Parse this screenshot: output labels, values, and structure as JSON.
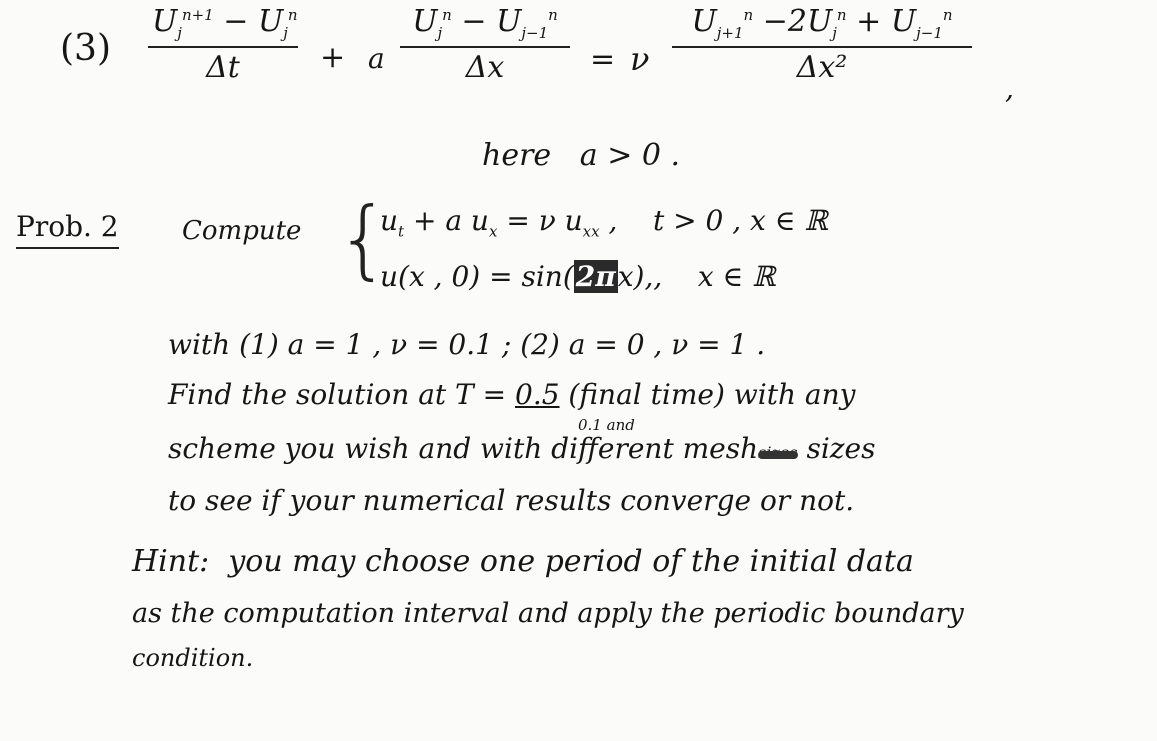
{
  "equation3": {
    "label": "(3)",
    "term1": {
      "numerator": "U_j^{n+1} − U_j^n",
      "num_a": "U",
      "num_a_sup": "n+1",
      "num_a_sub": "j",
      "num_op": "−",
      "num_b": "U",
      "num_b_sup": "n",
      "num_b_sub": "j",
      "denominator": "Δt"
    },
    "plus": "+",
    "coef": "a",
    "term2": {
      "num_a": "U",
      "num_a_sup": "n",
      "num_a_sub": "j",
      "num_op": "−",
      "num_b": "U",
      "num_b_sup": "n",
      "num_b_sub": "j−1",
      "denominator": "Δx"
    },
    "equals": "=",
    "nu": "ν",
    "term3": {
      "num_a": "U",
      "num_a_sup": "n",
      "num_a_sub": "j+1",
      "num_mid": "−2",
      "num_b": "U",
      "num_b_sup": "n",
      "num_b_sub": "j",
      "num_op": "+",
      "num_c": "U",
      "num_c_sup": "n",
      "num_c_sub": "j−1",
      "denominator": "Δx²"
    },
    "trailing": ",",
    "condition": "here   a > 0 ."
  },
  "problem": {
    "title": "Prob. 2",
    "verb": "Compute",
    "pde_line": "u_t + a u_x = ν u_xx ,    t > 0 , x ∈ ℝ",
    "pde_lhs": "u",
    "pde_t": "t",
    "pde_mid": " + a u",
    "pde_x": "x",
    "pde_eq": " = ν u",
    "pde_xx": "xx",
    "pde_cond": " ,    t > 0 , x ∈ ℝ",
    "ic_lhs": "u(x , 0) = sin",
    "ic_arg_open": "(",
    "ic_arg_highlight": "2π",
    "ic_arg_rest": "x),",
    "ic_cond": ",    x ∈ ℝ",
    "cases_line": "with (1) a = 1 , ν = 0.1 ; (2) a = 0 , ν = 1 .",
    "find_line_a": "Find the solution at T = ",
    "find_T_value": "0.5",
    "find_T_annotation": "0.1 and",
    "find_line_b": " (final time) with any",
    "scheme_line_a": "scheme you wish and with different mesh",
    "scheme_struck": "sizes",
    "scheme_line_b": " sizes",
    "converge_line": "to see if your numerical results converge or not."
  },
  "hint": {
    "line1": "Hint:  you may choose one period of the initial data",
    "line2": "as the computation interval and apply the periodic boundary",
    "line3": "condition."
  }
}
